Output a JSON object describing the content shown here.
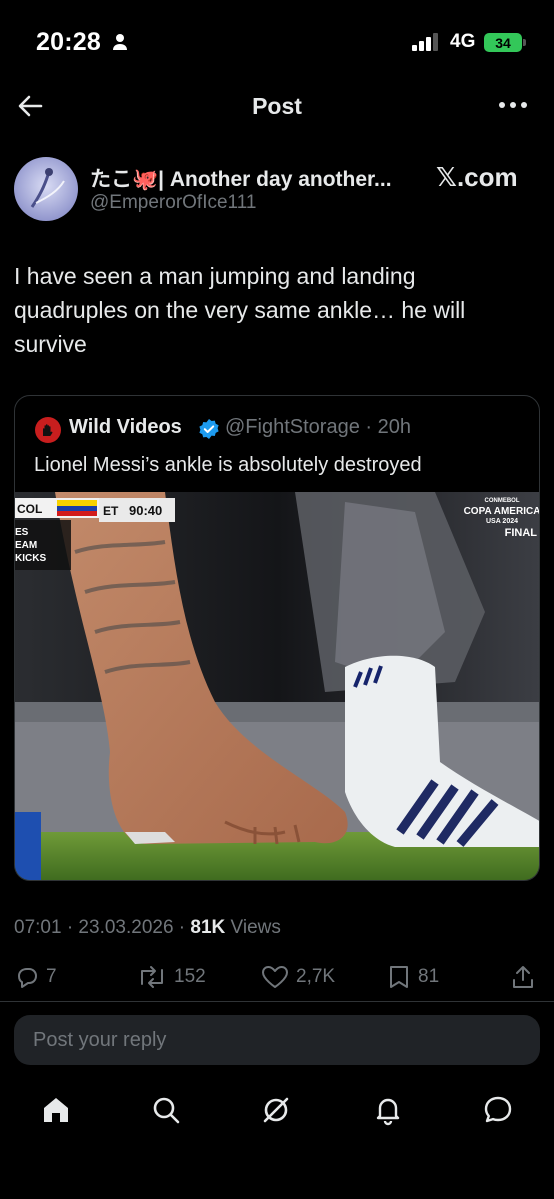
{
  "status_bar": {
    "time": "20:28",
    "network": "4G",
    "battery": "34"
  },
  "header": {
    "title": "Post"
  },
  "author": {
    "name": "たこ🐙| Another day another...",
    "handle": "@EmperorOfIce111",
    "source_label": "𝕏.com"
  },
  "post": {
    "text": "I have seen a man jumping and landing quadruples on the very same ankle… he will survive"
  },
  "quoted": {
    "name": "Wild Videos",
    "handle_time": "@FightStorage · 20h",
    "text": "Lionel Messi’s ankle is absolutely destroyed",
    "scoreboard": {
      "team": "COL",
      "period": "ET",
      "clock": "90:40",
      "side_lines": [
        "ES",
        "EAM",
        "KICKS"
      ],
      "tournament_top": "CONMEBOL",
      "tournament": "COPA AMERICA",
      "tournament_sub": "USA 2024",
      "stage": "FINAL"
    }
  },
  "meta": {
    "time_date": "07:01 · 23.03.2026 · ",
    "views_count": "81K",
    "views_label": " Views"
  },
  "actions": {
    "replies": "7",
    "reposts": "152",
    "likes": "2,7K",
    "bookmarks": "81"
  },
  "reply": {
    "placeholder": "Post your reply"
  },
  "colors": {
    "background": "#000000",
    "text": "#e7e9ea",
    "muted": "#71767b",
    "verified": "#1d9bf0",
    "battery": "#33c759"
  }
}
